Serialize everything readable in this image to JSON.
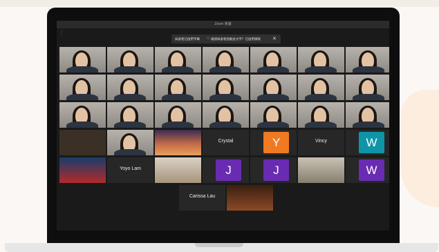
{
  "window": {
    "title": "Zoom 會議"
  },
  "banner": {
    "text1": "與會者已啟用字幕",
    "text2": "邀請與會者啟動此文字？已啟用擷取",
    "close_glyph": "✕"
  },
  "participants": {
    "crystal": "Crystal",
    "vincy": "Vincy",
    "yoyo": "Yoyo Lam",
    "carissa": "Carissa Lau"
  },
  "avatars": {
    "y": {
      "letter": "Y",
      "color": "#f07a21"
    },
    "w1": {
      "letter": "W",
      "color": "#0f95a8"
    },
    "j1": {
      "letter": "J",
      "color": "#6a2bb3"
    },
    "j2": {
      "letter": "J",
      "color": "#6a2bb3"
    },
    "w2": {
      "letter": "W",
      "color": "#6a2bb3"
    }
  }
}
